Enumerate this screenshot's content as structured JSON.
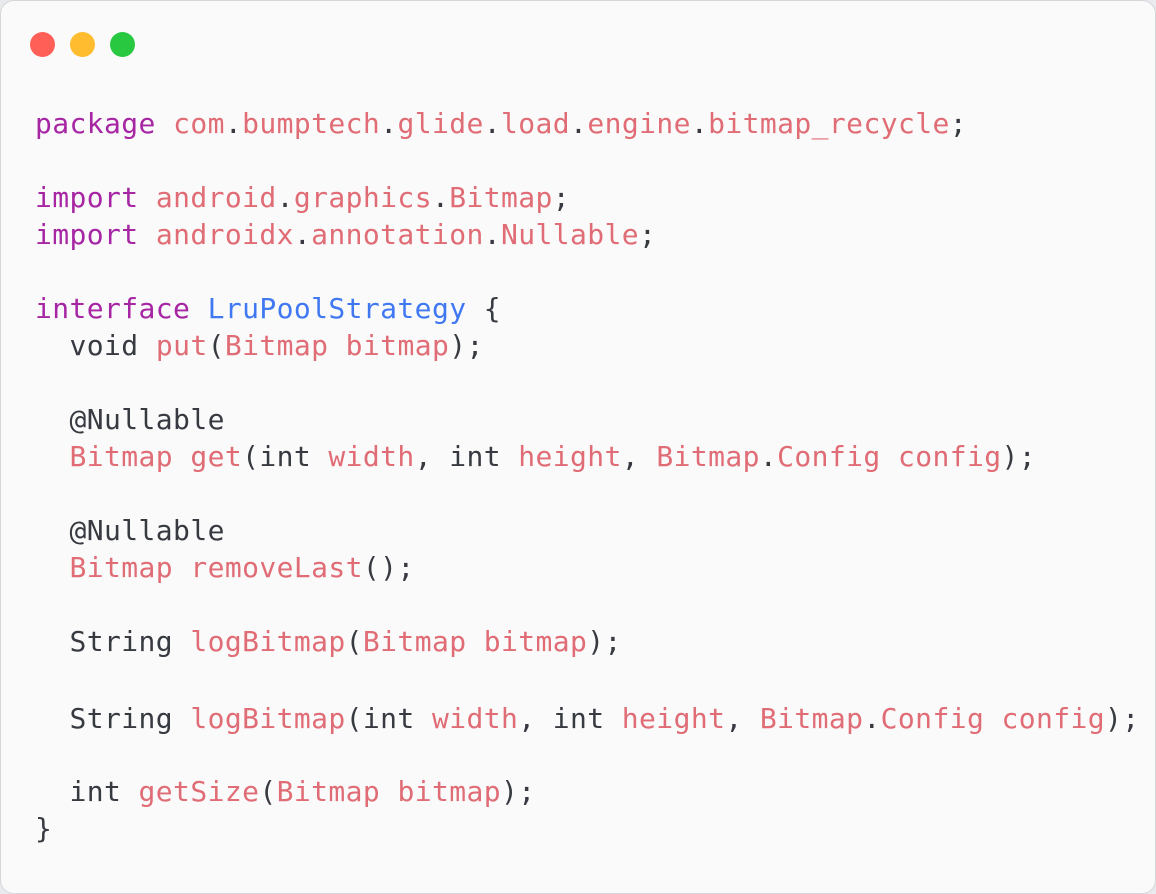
{
  "window": {
    "traffic_lights": [
      "close",
      "minimize",
      "maximize"
    ],
    "colors": {
      "background": "#fafafa",
      "close": "#ff5f57",
      "minimize": "#febc2e",
      "maximize": "#28c840"
    }
  },
  "syntax_colors": {
    "plain": "#383a42",
    "keyword": "#a626a4",
    "identifier": "#e06c75",
    "type_name": "#4078f2"
  },
  "code": {
    "lines": [
      {
        "tokens": [
          {
            "text": "package",
            "kind": "keyword"
          },
          {
            "text": " ",
            "kind": "plain"
          },
          {
            "text": "com",
            "kind": "identifier"
          },
          {
            "text": ".",
            "kind": "plain"
          },
          {
            "text": "bumptech",
            "kind": "identifier"
          },
          {
            "text": ".",
            "kind": "plain"
          },
          {
            "text": "glide",
            "kind": "identifier"
          },
          {
            "text": ".",
            "kind": "plain"
          },
          {
            "text": "load",
            "kind": "identifier"
          },
          {
            "text": ".",
            "kind": "plain"
          },
          {
            "text": "engine",
            "kind": "identifier"
          },
          {
            "text": ".",
            "kind": "plain"
          },
          {
            "text": "bitmap_recycle",
            "kind": "identifier"
          },
          {
            "text": ";",
            "kind": "plain"
          }
        ]
      },
      {
        "blank": true,
        "gap": "m"
      },
      {
        "tokens": [
          {
            "text": "import",
            "kind": "keyword"
          },
          {
            "text": " ",
            "kind": "plain"
          },
          {
            "text": "android",
            "kind": "identifier"
          },
          {
            "text": ".",
            "kind": "plain"
          },
          {
            "text": "graphics",
            "kind": "identifier"
          },
          {
            "text": ".",
            "kind": "plain"
          },
          {
            "text": "Bitmap",
            "kind": "identifier"
          },
          {
            "text": ";",
            "kind": "plain"
          }
        ]
      },
      {
        "tokens": [
          {
            "text": "import",
            "kind": "keyword"
          },
          {
            "text": " ",
            "kind": "plain"
          },
          {
            "text": "androidx",
            "kind": "identifier"
          },
          {
            "text": ".",
            "kind": "plain"
          },
          {
            "text": "annotation",
            "kind": "identifier"
          },
          {
            "text": ".",
            "kind": "plain"
          },
          {
            "text": "Nullable",
            "kind": "identifier"
          },
          {
            "text": ";",
            "kind": "plain"
          }
        ]
      },
      {
        "blank": true,
        "gap": "m"
      },
      {
        "tokens": [
          {
            "text": "interface",
            "kind": "keyword"
          },
          {
            "text": " ",
            "kind": "plain"
          },
          {
            "text": "LruPoolStrategy",
            "kind": "type_name"
          },
          {
            "text": " {",
            "kind": "plain"
          }
        ]
      },
      {
        "tokens": [
          {
            "text": "  void ",
            "kind": "plain"
          },
          {
            "text": "put",
            "kind": "identifier"
          },
          {
            "text": "(",
            "kind": "plain"
          },
          {
            "text": "Bitmap",
            "kind": "identifier"
          },
          {
            "text": " ",
            "kind": "plain"
          },
          {
            "text": "bitmap",
            "kind": "identifier"
          },
          {
            "text": ");",
            "kind": "plain"
          }
        ]
      },
      {
        "blank": true,
        "gap": "m"
      },
      {
        "tokens": [
          {
            "text": "  @Nullable",
            "kind": "plain"
          }
        ]
      },
      {
        "tokens": [
          {
            "text": "  ",
            "kind": "plain"
          },
          {
            "text": "Bitmap",
            "kind": "identifier"
          },
          {
            "text": " ",
            "kind": "plain"
          },
          {
            "text": "get",
            "kind": "identifier"
          },
          {
            "text": "(int ",
            "kind": "plain"
          },
          {
            "text": "width",
            "kind": "identifier"
          },
          {
            "text": ", int ",
            "kind": "plain"
          },
          {
            "text": "height",
            "kind": "identifier"
          },
          {
            "text": ", ",
            "kind": "plain"
          },
          {
            "text": "Bitmap",
            "kind": "identifier"
          },
          {
            "text": ".",
            "kind": "plain"
          },
          {
            "text": "Config",
            "kind": "identifier"
          },
          {
            "text": " ",
            "kind": "plain"
          },
          {
            "text": "config",
            "kind": "identifier"
          },
          {
            "text": ");",
            "kind": "plain"
          }
        ]
      },
      {
        "blank": true,
        "gap": "m"
      },
      {
        "tokens": [
          {
            "text": "  @Nullable",
            "kind": "plain"
          }
        ]
      },
      {
        "tokens": [
          {
            "text": "  ",
            "kind": "plain"
          },
          {
            "text": "Bitmap",
            "kind": "identifier"
          },
          {
            "text": " ",
            "kind": "plain"
          },
          {
            "text": "removeLast",
            "kind": "identifier"
          },
          {
            "text": "();",
            "kind": "plain"
          }
        ]
      },
      {
        "blank": true,
        "gap": "m"
      },
      {
        "tokens": [
          {
            "text": "  String ",
            "kind": "plain"
          },
          {
            "text": "logBitmap",
            "kind": "identifier"
          },
          {
            "text": "(",
            "kind": "plain"
          },
          {
            "text": "Bitmap",
            "kind": "identifier"
          },
          {
            "text": " ",
            "kind": "plain"
          },
          {
            "text": "bitmap",
            "kind": "identifier"
          },
          {
            "text": ");",
            "kind": "plain"
          }
        ]
      },
      {
        "blank": true,
        "gap": "l"
      },
      {
        "tokens": [
          {
            "text": "  String ",
            "kind": "plain"
          },
          {
            "text": "logBitmap",
            "kind": "identifier"
          },
          {
            "text": "(int ",
            "kind": "plain"
          },
          {
            "text": "width",
            "kind": "identifier"
          },
          {
            "text": ", int ",
            "kind": "plain"
          },
          {
            "text": "height",
            "kind": "identifier"
          },
          {
            "text": ", ",
            "kind": "plain"
          },
          {
            "text": "Bitmap",
            "kind": "identifier"
          },
          {
            "text": ".",
            "kind": "plain"
          },
          {
            "text": "Config",
            "kind": "identifier"
          },
          {
            "text": " ",
            "kind": "plain"
          },
          {
            "text": "config",
            "kind": "identifier"
          },
          {
            "text": ");",
            "kind": "plain"
          }
        ]
      },
      {
        "blank": true,
        "gap": "s"
      },
      {
        "tokens": [
          {
            "text": "  int ",
            "kind": "plain"
          },
          {
            "text": "getSize",
            "kind": "identifier"
          },
          {
            "text": "(",
            "kind": "plain"
          },
          {
            "text": "Bitmap",
            "kind": "identifier"
          },
          {
            "text": " ",
            "kind": "plain"
          },
          {
            "text": "bitmap",
            "kind": "identifier"
          },
          {
            "text": ");",
            "kind": "plain"
          }
        ]
      },
      {
        "tokens": [
          {
            "text": "}",
            "kind": "plain"
          }
        ]
      }
    ]
  }
}
